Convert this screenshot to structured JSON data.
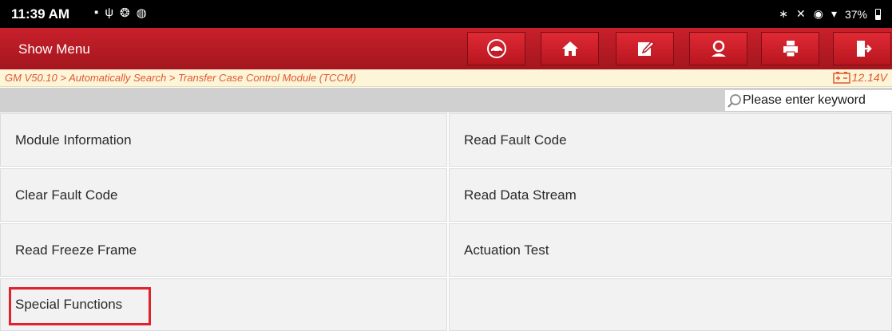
{
  "status_bar": {
    "time": "11:39 AM",
    "left_icons": [
      "image-icon",
      "usb-icon",
      "settings-icon",
      "chat-icon"
    ],
    "right_icons": [
      "bluetooth-icon",
      "mute-icon",
      "location-icon",
      "wifi-icon"
    ],
    "battery": "37%"
  },
  "toolbar": {
    "title": "Show Menu",
    "buttons": [
      {
        "name": "obd-button",
        "icon": "car-icon"
      },
      {
        "name": "home-button",
        "icon": "home-icon"
      },
      {
        "name": "report-button",
        "icon": "edit-icon"
      },
      {
        "name": "remote-button",
        "icon": "remote-support-icon"
      },
      {
        "name": "print-button",
        "icon": "print-icon"
      },
      {
        "name": "exit-button",
        "icon": "exit-icon"
      }
    ]
  },
  "breadcrumb": {
    "path": "GM V50.10 > Automatically Search > Transfer Case Control Module (TCCM)",
    "voltage": "12.14V"
  },
  "search": {
    "placeholder": "Please enter keyword"
  },
  "menu": {
    "items": [
      "Module Information",
      "Read Fault Code",
      "Clear Fault Code",
      "Read Data Stream",
      "Read Freeze Frame",
      "Actuation Test",
      "Special Functions",
      ""
    ],
    "highlighted": "Special Functions"
  },
  "colors": {
    "toolbar_red": "#b8161f",
    "breadcrumb_text": "#e05a30",
    "highlight": "#e0222c"
  }
}
